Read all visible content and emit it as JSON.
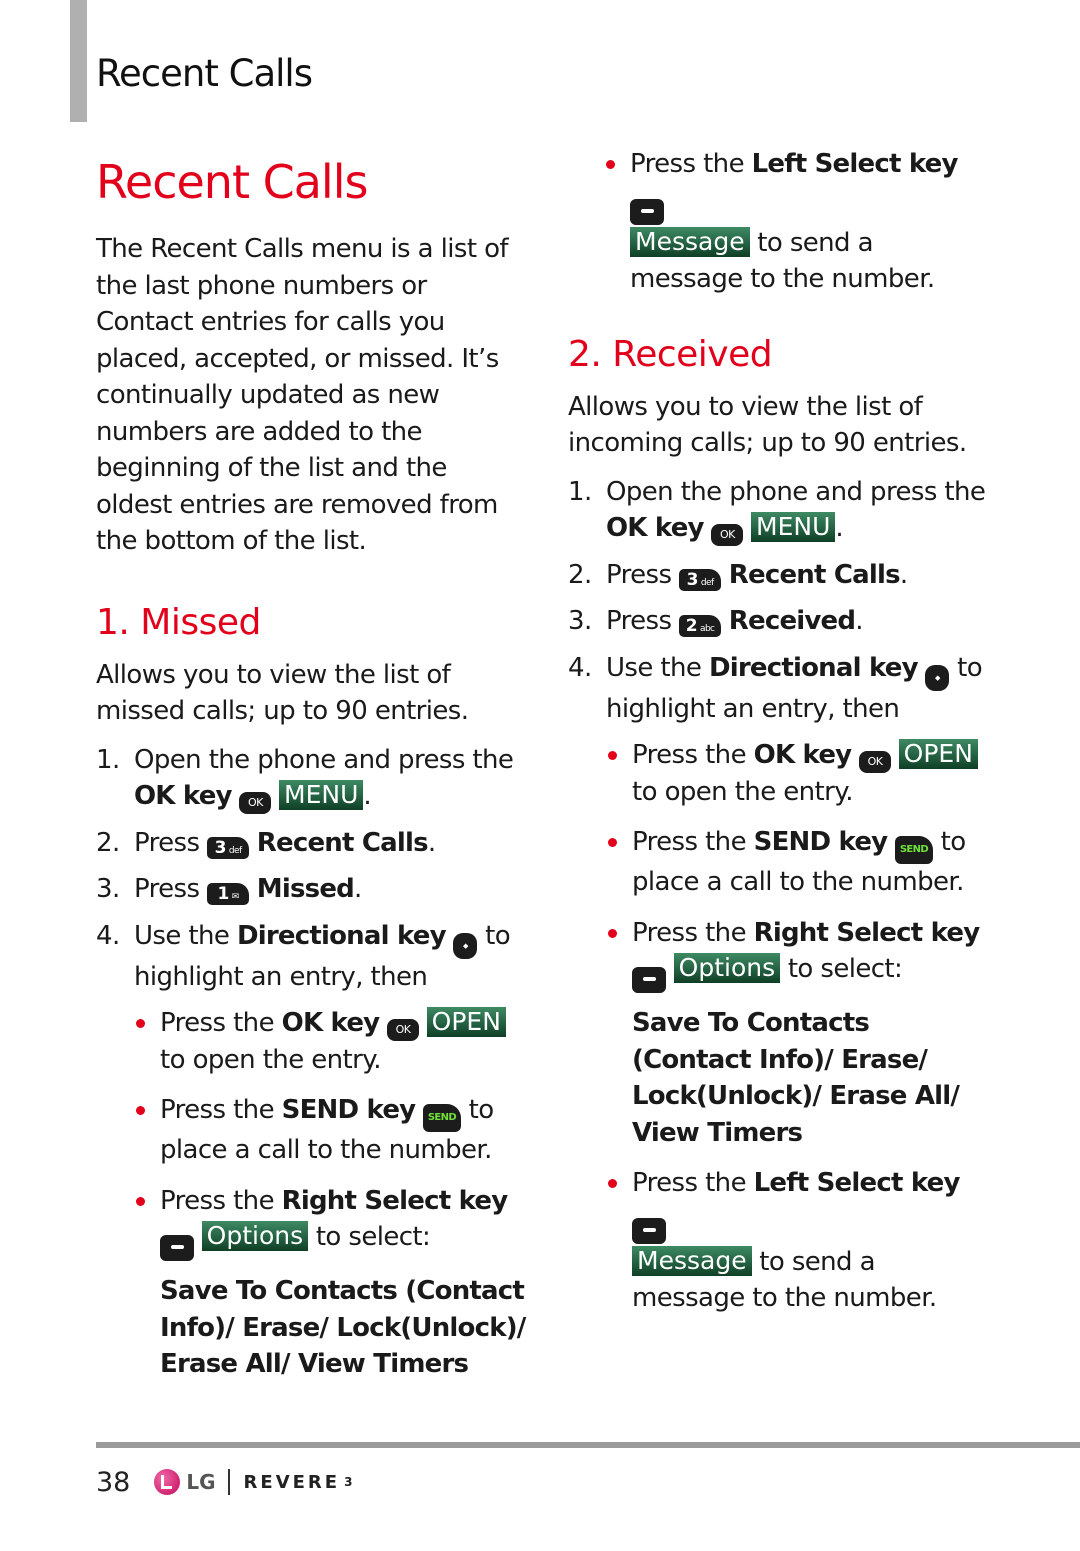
{
  "running_head": "Recent Calls",
  "colors": {
    "accent_red": "#e2001a",
    "softkey_green": "#1f5c3c",
    "send_green": "#6fe03a"
  },
  "left": {
    "title": "Recent Calls",
    "intro": "The Recent Calls menu is a list of the last phone numbers or Contact entries for calls you placed, accepted, or missed. It’s continually updated as new numbers are added to the beginning of the list and the oldest entries are removed from the bottom of the list.",
    "section": {
      "title": "1. Missed",
      "desc": "Allows you to view the list of missed calls; up to 90 entries.",
      "step1": {
        "num": "1.",
        "text": "Open the phone and press the",
        "key_name": "OK key",
        "key_glyph": "OK",
        "softkey": "MENU",
        "end": "."
      },
      "step2": {
        "num": "2.",
        "text": "Press",
        "key_glyph": "3",
        "key_sub": "def",
        "target": "Recent Calls",
        "end": "."
      },
      "step3": {
        "num": "3.",
        "text": "Press",
        "key_glyph": "1",
        "key_sub": "✉",
        "target": "Missed",
        "end": "."
      },
      "step4": {
        "num": "4.",
        "text": "Use the",
        "key_name": "Directional key",
        "after": "to highlight an entry, then"
      },
      "bullet_open": {
        "pre": "Press the",
        "key_name": "OK key",
        "key_glyph": "OK",
        "softkey": "OPEN",
        "post": "to open the entry."
      },
      "bullet_send": {
        "pre": "Press the",
        "key_name": "SEND key",
        "key_glyph": "SEND",
        "post": "to place a call to the number."
      },
      "bullet_options": {
        "pre": "Press the",
        "key_name": "Right Select key",
        "softkey": "Options",
        "post": "to select:",
        "options": "Save To Contacts (Contact Info)/ Erase/ Lock(Unlock)/ Erase All/ View Timers"
      }
    }
  },
  "right": {
    "bullet_message_top": {
      "pre": "Press the",
      "key_name": "Left Select key",
      "softkey": "Message",
      "post": "to send a message to the number."
    },
    "section": {
      "title": "2. Received",
      "desc": "Allows you to view the list of incoming calls; up to 90 entries.",
      "step1": {
        "num": "1.",
        "text": "Open the phone and press the",
        "key_name": "OK key",
        "key_glyph": "OK",
        "softkey": "MENU",
        "end": "."
      },
      "step2": {
        "num": "2.",
        "text": "Press",
        "key_glyph": "3",
        "key_sub": "def",
        "target": "Recent Calls",
        "end": "."
      },
      "step3": {
        "num": "3.",
        "text": "Press",
        "key_glyph": "2",
        "key_sub": "abc",
        "target": "Received",
        "end": "."
      },
      "step4": {
        "num": "4.",
        "text": "Use the",
        "key_name": "Directional key",
        "after": "to highlight an entry, then"
      },
      "bullet_open": {
        "pre": "Press the",
        "key_name": "OK key",
        "key_glyph": "OK",
        "softkey": "OPEN",
        "post": "to open the entry."
      },
      "bullet_send": {
        "pre": "Press the",
        "key_name": "SEND key",
        "key_glyph": "SEND",
        "post": "to place a call to the number."
      },
      "bullet_options": {
        "pre": "Press the",
        "key_name": "Right Select key",
        "softkey": "Options",
        "post": "to select:",
        "options": "Save To Contacts (Contact Info)/ Erase/ Lock(Unlock)/ Erase All/ View Timers"
      },
      "bullet_message": {
        "pre": "Press the",
        "key_name": "Left Select key",
        "softkey": "Message",
        "post": "to send a message to the number."
      }
    }
  },
  "footer": {
    "page_number": "38",
    "brand_logo": "LG",
    "product": "REVERE",
    "product_version": "3"
  }
}
